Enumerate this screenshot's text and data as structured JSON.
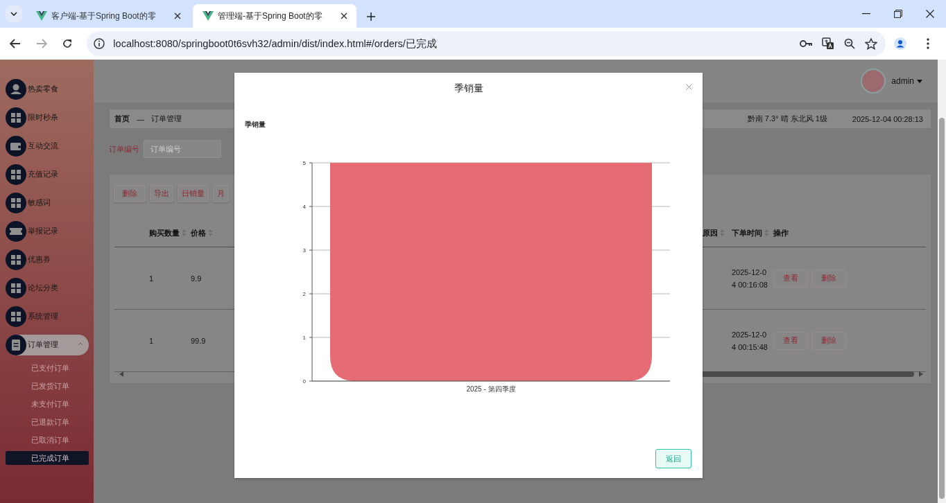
{
  "browser": {
    "tabs": [
      {
        "title": "客户端-基于Spring Boot的零",
        "selected": false
      },
      {
        "title": "管理端-基于Spring Boot的零",
        "selected": true
      }
    ],
    "url": "localhost:8080/springboot0t6svh32/admin/dist/index.html#/orders/已完成"
  },
  "sidebar": {
    "items": [
      {
        "label": "热卖零食",
        "kind": "user"
      },
      {
        "label": "限时秒杀",
        "kind": "grid"
      },
      {
        "label": "互动交流",
        "kind": "wallet"
      },
      {
        "label": "充值记录",
        "kind": "grid"
      },
      {
        "label": "敏感词",
        "kind": "grid"
      },
      {
        "label": "举报记录",
        "kind": "ticket"
      },
      {
        "label": "优惠券",
        "kind": "grid"
      },
      {
        "label": "论坛分类",
        "kind": "grid"
      },
      {
        "label": "系统管理",
        "kind": "grid",
        "expanded": false
      },
      {
        "label": "订单管理",
        "kind": "clipboard",
        "expanded": true,
        "children": [
          {
            "label": "已支付订单",
            "selected": false
          },
          {
            "label": "已发货订单",
            "selected": false
          },
          {
            "label": "未支付订单",
            "selected": false
          },
          {
            "label": "已退款订单",
            "selected": false
          },
          {
            "label": "已取消订单",
            "selected": false
          },
          {
            "label": "已完成订单",
            "selected": true
          }
        ]
      }
    ]
  },
  "header": {
    "user": "admin"
  },
  "breadcrumb": {
    "items": [
      "首页",
      "订单管理"
    ],
    "separator": "—"
  },
  "info_bar": {
    "weather": "黔南 7.3° 晴 东北风 1级",
    "datetime": "2025-12-04 00:28:13"
  },
  "search": {
    "label": "订单编号",
    "placeholder": "订单编号"
  },
  "toolbar": [
    "删除",
    "导出",
    "日销量",
    "月"
  ],
  "table": {
    "left_columns": [
      {
        "label": "购买数量",
        "sortable": true
      },
      {
        "label": "价格",
        "sortable": true
      }
    ],
    "right_columns": [
      {
        "label": "原因",
        "sortable": true
      },
      {
        "label": "下单时间",
        "sortable": true
      },
      {
        "label": "操作",
        "sortable": false
      }
    ],
    "rows": [
      {
        "quantity": "1",
        "price": "9.9",
        "order_time": "2025-12-04 00:16:08",
        "actions": [
          "查看",
          "删除"
        ]
      },
      {
        "quantity": "1",
        "price": "99.9",
        "order_time": "2025-12-04 00:15:48",
        "actions": [
          "查看",
          "删除"
        ]
      }
    ]
  },
  "dialog": {
    "title": "季销量",
    "button": "返回",
    "chart_data": {
      "type": "bar",
      "title": "季销量",
      "categories": [
        "2025 - 第四季度"
      ],
      "series": [
        {
          "color": "#e56b75",
          "values": [
            5
          ]
        }
      ],
      "grid": true,
      "ylim": [
        0,
        5
      ],
      "yticks": [
        0,
        1,
        2,
        3,
        4,
        5
      ]
    }
  }
}
